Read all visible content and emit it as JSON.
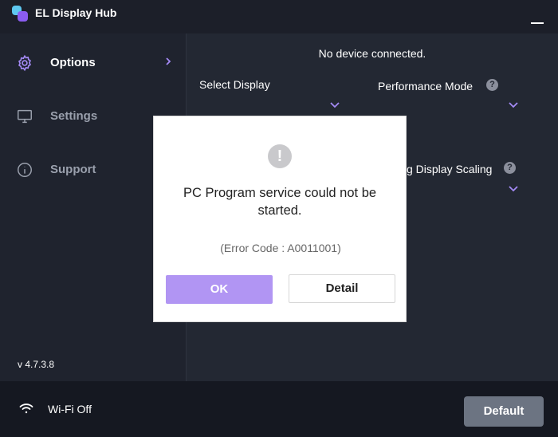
{
  "app": {
    "title": "EL Display Hub",
    "version": "v 4.7.3.8",
    "colors": {
      "accent": "#9b7cf0",
      "ok_button": "#b195f3",
      "default_button": "#6c7482",
      "background": "#1f232e"
    }
  },
  "titlebar": {
    "minimize_icon": "minimize-icon"
  },
  "sidebar": {
    "items": [
      {
        "label": "Options",
        "icon": "gear-icon",
        "active": true
      },
      {
        "label": "Settings",
        "icon": "monitor-icon",
        "active": false
      },
      {
        "label": "Support",
        "icon": "info-icon",
        "active": false
      }
    ]
  },
  "main": {
    "status": "No device connected.",
    "select_display_label": "Select Display",
    "performance_mode_label": "Performance Mode",
    "scaling_label": "g Display Scaling",
    "help_glyph": "?"
  },
  "dialog": {
    "alert_glyph": "!",
    "message": "PC Program service could not be started.",
    "error_code": "(Error Code : A0011001)",
    "ok_label": "OK",
    "detail_label": "Detail"
  },
  "footer": {
    "wifi_label": "Wi-Fi Off",
    "default_label": "Default"
  }
}
